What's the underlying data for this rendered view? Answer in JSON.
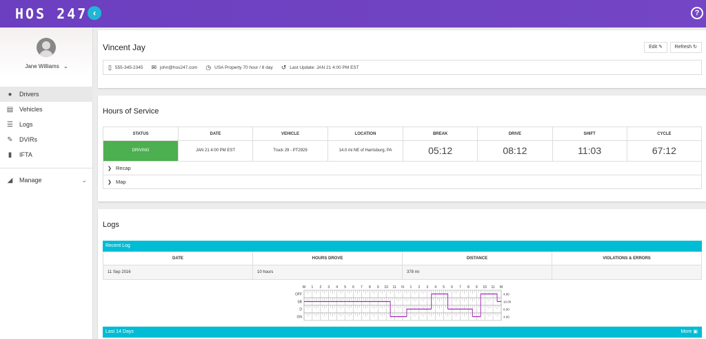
{
  "app": {
    "logo": "HOS 247",
    "collapse_icon": "chevron-left-icon",
    "help_icon": "help-icon",
    "help_glyph": "?",
    "collapse_glyph": "‹"
  },
  "user": {
    "name": "Jane Williams",
    "chevron": "⌄"
  },
  "nav": {
    "items": [
      {
        "label": "Drivers",
        "icon": "person-icon",
        "glyph": "●",
        "active": true
      },
      {
        "label": "Vehicles",
        "icon": "bus-icon",
        "glyph": "▤",
        "active": false
      },
      {
        "label": "Logs",
        "icon": "list-icon",
        "glyph": "☰",
        "active": false
      },
      {
        "label": "DVIRs",
        "icon": "wrench-icon",
        "glyph": "✎",
        "active": false
      },
      {
        "label": "IFTA",
        "icon": "fuel-icon",
        "glyph": "▮",
        "active": false
      }
    ],
    "manage": {
      "label": "Manage",
      "icon": "settings-icon",
      "glyph": "◢",
      "chevron": "⌄"
    }
  },
  "driver": {
    "name": "Vincent Jay",
    "edit_label": "Edit ✎",
    "refresh_label": "Refresh ↻",
    "phone": "555-345-2345",
    "email": "john@hos247.com",
    "ruleset": "USA Property 70 hour / 8 day",
    "last_update": "Last Update: JAN 21 4:00 PM EST"
  },
  "hos": {
    "title": "Hours of Service",
    "headers": [
      "STATUS",
      "DATE",
      "VEHICLE",
      "LOCATION",
      "BREAK",
      "DRIVE",
      "SHIFT",
      "CYCLE"
    ],
    "status": "DRIVING",
    "date": "JAN 21 4:00 PM EST",
    "vehicle": "Truck 29 - PT2929",
    "location": "14.0 mi NE of Harrisburg, PA",
    "break": "05:12",
    "drive": "08:12",
    "shift": "11:03",
    "cycle": "67:12",
    "recap_label": "Recap",
    "map_label": "Map",
    "status_color": "#4caf50"
  },
  "logs": {
    "title": "Logs",
    "recent_label": "Recent Log",
    "headers": [
      "DATE",
      "HOURS DROVE",
      "DISTANCE",
      "VIOLATIONS & ERRORS"
    ],
    "row": {
      "date": "11 Sep 2016",
      "hours": "10 hours",
      "distance": "378 mi",
      "violations": ""
    },
    "last14_label": "Last 14 Days",
    "more_label": "More",
    "graph": {
      "hour_labels": [
        "M",
        "1",
        "2",
        "3",
        "4",
        "5",
        "6",
        "7",
        "8",
        "9",
        "10",
        "11",
        "N",
        "1",
        "2",
        "3",
        "4",
        "5",
        "6",
        "7",
        "8",
        "9",
        "10",
        "11",
        "M"
      ],
      "rows": [
        "OFF",
        "SB",
        "D",
        "ON"
      ],
      "totals": [
        "4.00",
        "10.00",
        "6.00",
        "4.00"
      ],
      "line_color": "#9c27b0",
      "segments": [
        {
          "row": 1,
          "from": 0,
          "to": 10.5
        },
        {
          "row": 3,
          "from": 10.5,
          "to": 12.5
        },
        {
          "row": 2,
          "from": 12.5,
          "to": 15.5
        },
        {
          "row": 0,
          "from": 15.5,
          "to": 17.5
        },
        {
          "row": 2,
          "from": 17.5,
          "to": 20.5
        },
        {
          "row": 3,
          "from": 20.5,
          "to": 21.5
        },
        {
          "row": 0,
          "from": 21.5,
          "to": 23.5
        },
        {
          "row": 1,
          "from": 23.5,
          "to": 24
        }
      ]
    },
    "accent": "#00bcd4"
  }
}
